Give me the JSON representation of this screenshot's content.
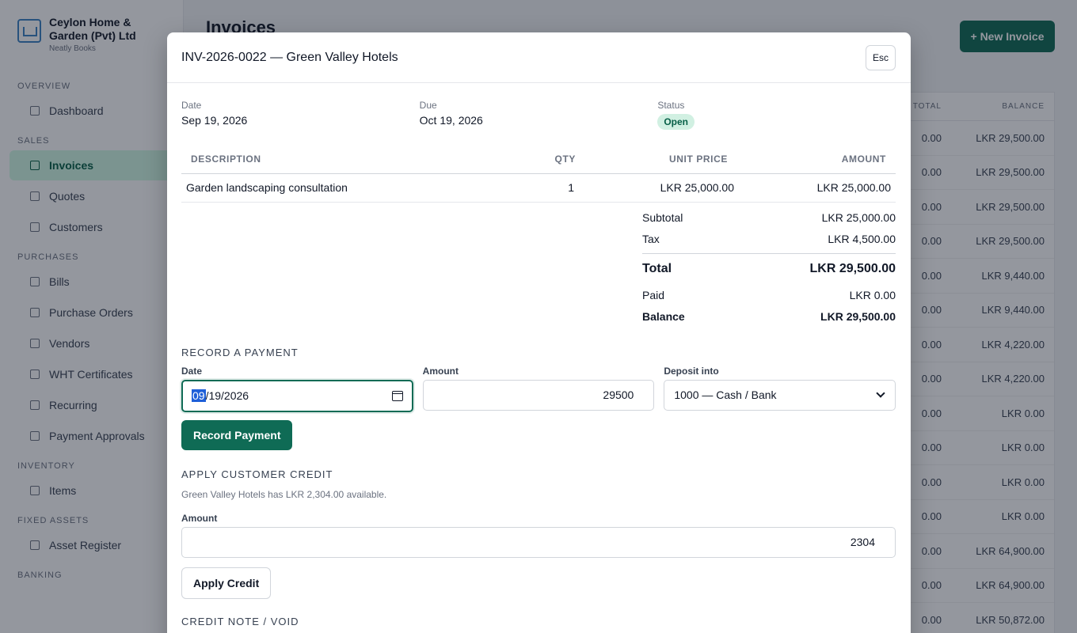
{
  "app": {
    "company_name": "Ceylon Home & Garden (Pvt) Ltd",
    "product_name": "Neatly Books",
    "page_title": "Invoices",
    "new_invoice_label": "+ New Invoice"
  },
  "sidebar": {
    "sections": [
      {
        "title": "OVERVIEW",
        "items": [
          {
            "label": "Dashboard",
            "icon": "dashboard-icon"
          }
        ]
      },
      {
        "title": "SALES",
        "items": [
          {
            "label": "Invoices",
            "icon": "document-icon",
            "active": true
          },
          {
            "label": "Quotes",
            "icon": "document-icon"
          },
          {
            "label": "Customers",
            "icon": "user-icon"
          }
        ]
      },
      {
        "title": "PURCHASES",
        "items": [
          {
            "label": "Bills",
            "icon": "bill-icon"
          },
          {
            "label": "Purchase Orders",
            "icon": "document-icon"
          },
          {
            "label": "Vendors",
            "icon": "vendor-icon"
          },
          {
            "label": "WHT Certificates",
            "icon": "certificate-icon"
          },
          {
            "label": "Recurring",
            "icon": "recurring-icon"
          },
          {
            "label": "Payment Approvals",
            "icon": "approval-icon"
          }
        ]
      },
      {
        "title": "INVENTORY",
        "items": [
          {
            "label": "Items",
            "icon": "box-icon"
          }
        ]
      },
      {
        "title": "FIXED ASSETS",
        "items": [
          {
            "label": "Asset Register",
            "icon": "register-icon"
          }
        ]
      },
      {
        "title": "BANKING",
        "items": []
      }
    ]
  },
  "background_table": {
    "headers": [
      "TOTAL",
      "BALANCE"
    ],
    "rows": [
      {
        "total": "0.00",
        "balance": "LKR 29,500.00"
      },
      {
        "total": "0.00",
        "balance": "LKR 29,500.00"
      },
      {
        "total": "0.00",
        "balance": "LKR 29,500.00"
      },
      {
        "total": "0.00",
        "balance": "LKR 29,500.00"
      },
      {
        "total": "0.00",
        "balance": "LKR 9,440.00"
      },
      {
        "total": "0.00",
        "balance": "LKR 9,440.00"
      },
      {
        "total": "0.00",
        "balance": "LKR 4,220.00"
      },
      {
        "total": "0.00",
        "balance": "LKR 4,220.00"
      },
      {
        "total": "0.00",
        "balance": "LKR 0.00"
      },
      {
        "total": "0.00",
        "balance": "LKR 0.00"
      },
      {
        "total": "0.00",
        "balance": "LKR 0.00"
      },
      {
        "total": "0.00",
        "balance": "LKR 0.00"
      },
      {
        "total": "0.00",
        "balance": "LKR 64,900.00"
      },
      {
        "total": "0.00",
        "balance": "LKR 64,900.00"
      },
      {
        "total": "0.00",
        "balance": "LKR 50,872.00"
      }
    ]
  },
  "modal": {
    "title": "INV-2026-0022 — Green Valley Hotels",
    "esc_label": "Esc",
    "meta": {
      "date_label": "Date",
      "date_value": "Sep 19, 2026",
      "due_label": "Due",
      "due_value": "Oct 19, 2026",
      "status_label": "Status",
      "status_value": "Open"
    },
    "line_items": {
      "headers": {
        "description": "DESCRIPTION",
        "qty": "QTY",
        "unit_price": "UNIT PRICE",
        "amount": "AMOUNT"
      },
      "rows": [
        {
          "description": "Garden landscaping consultation",
          "qty": "1",
          "unit_price": "LKR 25,000.00",
          "amount": "LKR 25,000.00"
        }
      ]
    },
    "totals": {
      "subtotal_label": "Subtotal",
      "subtotal_value": "LKR 25,000.00",
      "tax_label": "Tax",
      "tax_value": "LKR 4,500.00",
      "total_label": "Total",
      "total_value": "LKR 29,500.00",
      "paid_label": "Paid",
      "paid_value": "LKR 0.00",
      "balance_label": "Balance",
      "balance_value": "LKR 29,500.00"
    },
    "record_payment": {
      "section_title": "RECORD A PAYMENT",
      "date_label": "Date",
      "date_month": "09",
      "date_rest": "/19/2026",
      "amount_label": "Amount",
      "amount_value": "29500",
      "deposit_label": "Deposit into",
      "deposit_value": "1000 — Cash / Bank",
      "button_label": "Record Payment"
    },
    "apply_credit": {
      "section_title": "APPLY CUSTOMER CREDIT",
      "note": "Green Valley Hotels has LKR 2,304.00 available.",
      "amount_label": "Amount",
      "amount_value": "2304",
      "button_label": "Apply Credit"
    },
    "credit_note": {
      "section_title": "CREDIT NOTE / VOID"
    }
  },
  "colors": {
    "brand": "#0f6b55",
    "status_open_bg": "#d1f0e2",
    "overlay": "rgba(17,24,39,0.45)"
  }
}
